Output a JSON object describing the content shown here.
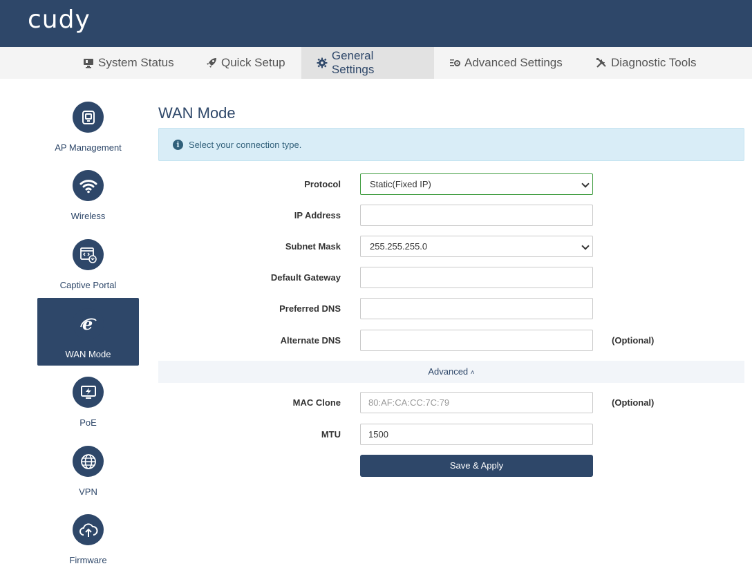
{
  "header": {
    "logo": "cudy"
  },
  "nav": {
    "items": [
      {
        "label": "System Status",
        "icon": "monitor-icon"
      },
      {
        "label": "Quick Setup",
        "icon": "rocket-icon"
      },
      {
        "label": "General Settings",
        "icon": "gear-icon",
        "active": true
      },
      {
        "label": "Advanced Settings",
        "icon": "sliders-gear-icon"
      },
      {
        "label": "Diagnostic Tools",
        "icon": "tools-icon"
      }
    ]
  },
  "sidebar": {
    "items": [
      {
        "label": "AP Management",
        "icon": "ap-device-icon"
      },
      {
        "label": "Wireless",
        "icon": "wifi-icon"
      },
      {
        "label": "Captive Portal",
        "icon": "portal-browser-icon"
      },
      {
        "label": "WAN Mode",
        "icon": "internet-e-icon",
        "active": true
      },
      {
        "label": "PoE",
        "icon": "poe-monitor-icon"
      },
      {
        "label": "VPN",
        "icon": "globe-icon"
      },
      {
        "label": "Firmware",
        "icon": "cloud-upload-icon"
      }
    ]
  },
  "main": {
    "title": "WAN Mode",
    "alert": "Select your connection type.",
    "form": {
      "protocol_label": "Protocol",
      "protocol_value": "Static(Fixed IP)",
      "ip_label": "IP Address",
      "ip_value": "",
      "subnet_label": "Subnet Mask",
      "subnet_value": "255.255.255.0",
      "gateway_label": "Default Gateway",
      "gateway_value": "",
      "pdns_label": "Preferred DNS",
      "pdns_value": "",
      "adns_label": "Alternate DNS",
      "adns_value": "",
      "optional": "(Optional)",
      "advanced_label": "Advanced",
      "mac_label": "MAC Clone",
      "mac_placeholder": "80:AF:CA:CC:7C:79",
      "mtu_label": "MTU",
      "mtu_value": "1500",
      "save_label": "Save & Apply"
    }
  },
  "colors": {
    "brand": "#2e4769",
    "alert_bg": "#d9edf7",
    "focus": "#3c9a3c"
  }
}
